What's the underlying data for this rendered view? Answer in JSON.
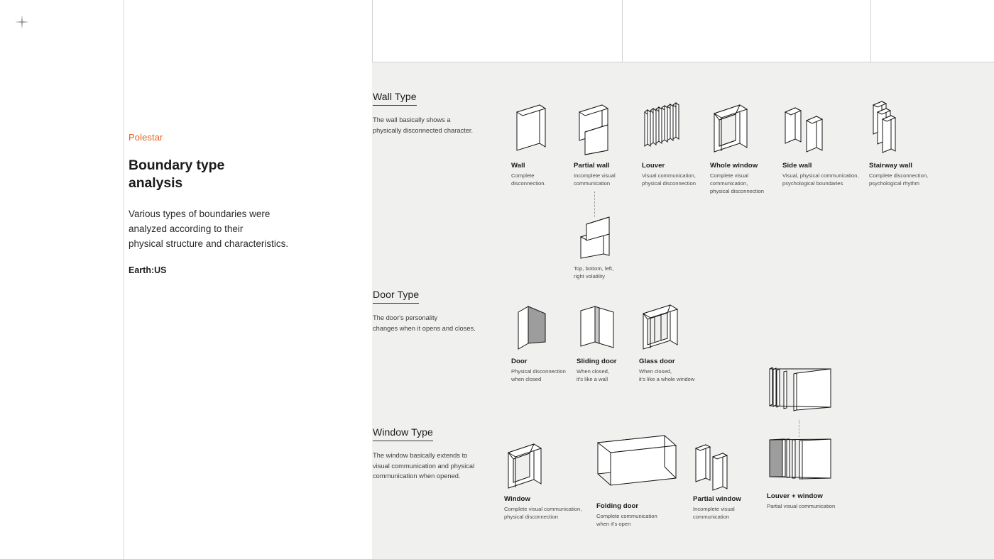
{
  "cursor": {
    "icon": "sparkle-cursor-icon"
  },
  "intro": {
    "brand": "Polestar",
    "headline_line1": "Boundary type",
    "headline_line2": "analysis",
    "lede_line1": "Various types of boundaries were",
    "lede_line2": "analyzed according to their",
    "lede_line3": "physical structure and characteristics.",
    "credit": "Earth:US"
  },
  "sections": [
    {
      "id": "wall-type",
      "title": "Wall Type",
      "desc_line1": "The wall basically shows a",
      "desc_line2": "physically disconnected character.",
      "items": [
        {
          "name": "Wall",
          "caption": "Complete\ndisconnection."
        },
        {
          "name": "Partial wall",
          "caption": "Incomplete visual\ncommunication"
        },
        {
          "name": "Louver",
          "caption": "Visual communication,\nphysical disconnection"
        },
        {
          "name": "Whole window",
          "caption": "Complete visual\ncommunication,\nphysical disconnection"
        },
        {
          "name": "Side wall",
          "caption": "Visual, physical communication,\npsychological boundaries"
        },
        {
          "name": "Stairway wall",
          "caption": "Complete disconnection,\npsychological rhythm"
        }
      ],
      "sub_items": [
        {
          "name": "",
          "caption": "Top, bottom, left,\nright volatility"
        }
      ]
    },
    {
      "id": "door-type",
      "title": "Door Type",
      "desc_line1": "The door's personality",
      "desc_line2": "changes when it opens and closes.",
      "items": [
        {
          "name": "Door",
          "caption": "Physical disconnection\nwhen closed"
        },
        {
          "name": "Sliding door",
          "caption": "When closed,\nit's like a wall"
        },
        {
          "name": "Glass door",
          "caption": "When closed,\nit's like a whole window"
        }
      ]
    },
    {
      "id": "window-type",
      "title": "Window Type",
      "desc_line1": "The window basically extends to",
      "desc_line2": "visual communication and physical",
      "desc_line3": "communication when opened.",
      "items": [
        {
          "name": "Window",
          "caption": "Complete visual communication,\nphysical disconnection"
        },
        {
          "name": "Folding door",
          "caption": "Complete communication\nwhen it's open"
        },
        {
          "name": "Partial window",
          "caption": "Incomplete visual\ncommunication"
        },
        {
          "name": "Louver + window",
          "caption": "Partial visual communication"
        }
      ]
    }
  ],
  "colors": {
    "accent": "#e8601c",
    "canvas": "#f0f0ef",
    "page": "#ffffff",
    "ink": "#1b1b1b",
    "muted": "#4a4a4a",
    "rule": "#d0d0d0",
    "shade": "#9d9d9d"
  }
}
